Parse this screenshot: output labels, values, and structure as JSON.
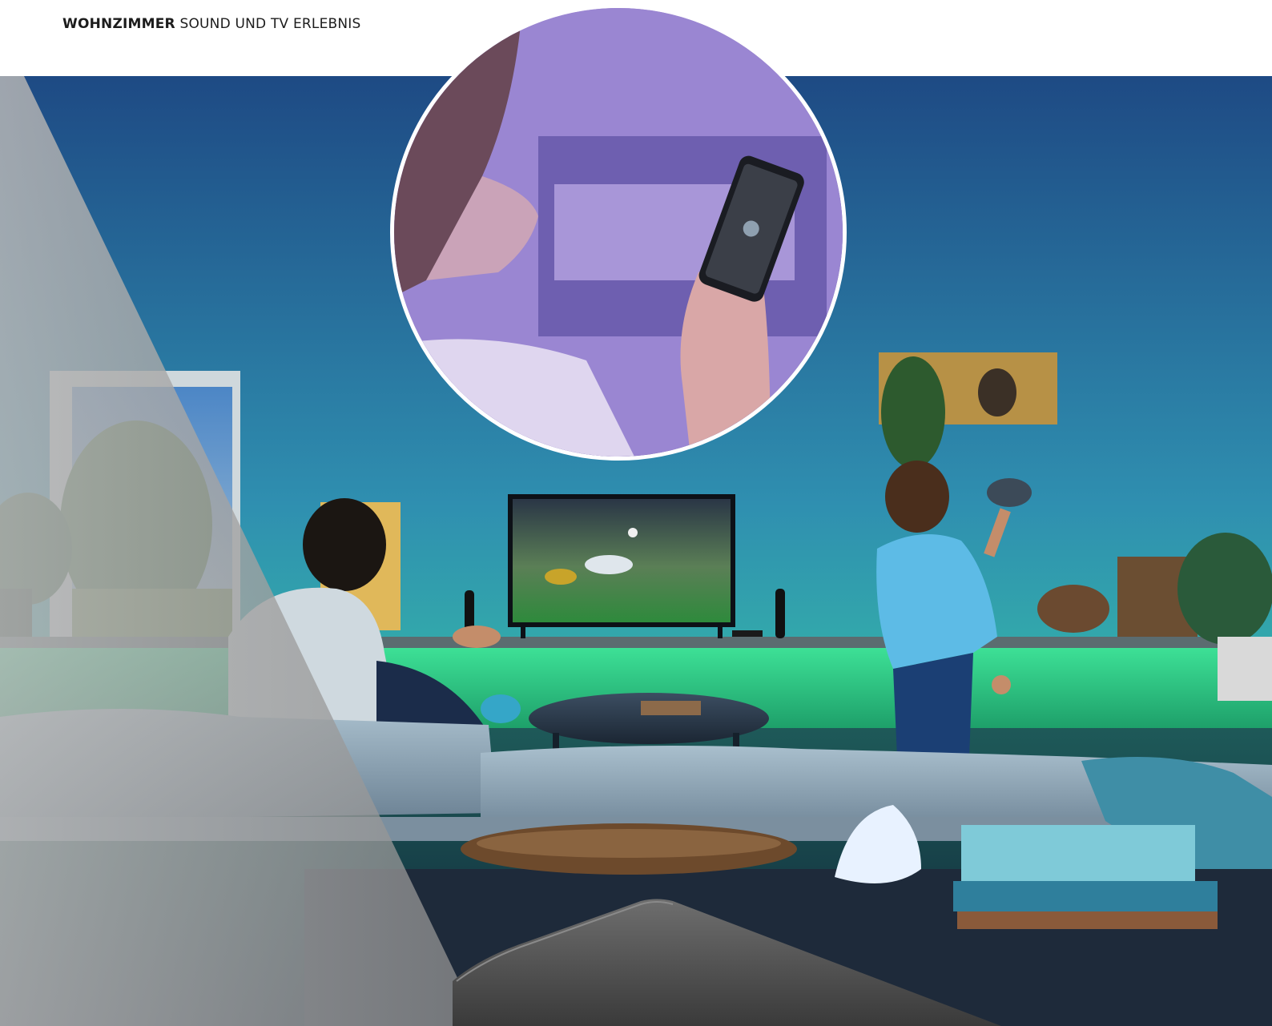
{
  "header": {
    "bold": "WOHNZIMMER",
    "rest": " SOUND UND TV ERLEBNIS"
  },
  "colors": {
    "wall_top": "#2a5a8e",
    "wall_mid": "#3fa7b5",
    "green_light": "#2fd685",
    "sofa": "#8aa2b3",
    "overlay": "#9a9a9a"
  },
  "scene": {
    "people": [
      "man-playing",
      "boy-playing",
      "woman-with-phone"
    ],
    "objects": [
      "tv",
      "speakers",
      "coffee-table",
      "sofa",
      "books",
      "bowl",
      "lamp",
      "window",
      "plant",
      "shelf"
    ]
  }
}
